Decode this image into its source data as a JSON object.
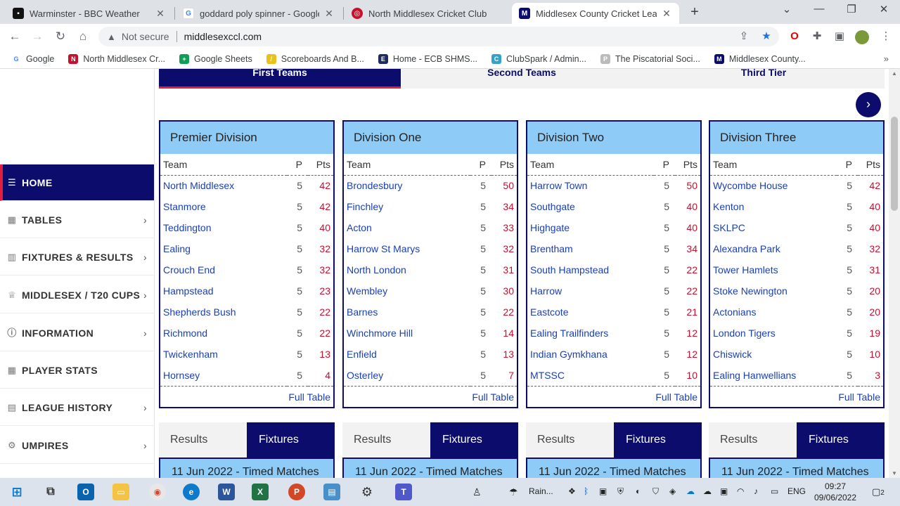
{
  "browser": {
    "tabs": [
      {
        "title": "Warminster - BBC Weather",
        "active": false
      },
      {
        "title": "goddard poly spinner - Google S",
        "active": false
      },
      {
        "title": "North Middlesex Cricket Club",
        "active": false
      },
      {
        "title": "Middlesex County Cricket League",
        "active": true
      }
    ],
    "new_tab": "+",
    "window": {
      "minimize": "—",
      "restore": "❐",
      "close": "✕",
      "tablist": "⌄"
    },
    "omnibox": {
      "security": "Not secure",
      "url": "middlesexccl.com"
    },
    "bookmarks": [
      {
        "label": "Google",
        "color": "#4285f4",
        "glyph": "G"
      },
      {
        "label": "North Middlesex Cr...",
        "color": "#c8102e",
        "glyph": "N"
      },
      {
        "label": "Google Sheets",
        "color": "#0f9d58",
        "glyph": "+"
      },
      {
        "label": "Scoreboards And B...",
        "color": "#e8c11a",
        "glyph": "/"
      },
      {
        "label": "Home - ECB SHMS...",
        "color": "#1f2b5c",
        "glyph": "E"
      },
      {
        "label": "ClubSpark / Admin...",
        "color": "#34a1c9",
        "glyph": "C"
      },
      {
        "label": "The Piscatorial Soci...",
        "color": "#bbbbbb",
        "glyph": "P"
      },
      {
        "label": "Middlesex County...",
        "color": "#0b0c6b",
        "glyph": "M"
      }
    ],
    "more": "»"
  },
  "sidebar": {
    "items": [
      {
        "label": "HOME",
        "icon": "☰",
        "active": true,
        "chevron": ""
      },
      {
        "label": "TABLES",
        "icon": "▦",
        "active": false,
        "chevron": "›"
      },
      {
        "label": "FIXTURES & RESULTS",
        "icon": "▥",
        "active": false,
        "chevron": "›"
      },
      {
        "label": "MIDDLESEX / T20 CUPS",
        "icon": "♕",
        "active": false,
        "chevron": "›"
      },
      {
        "label": "INFORMATION",
        "icon": "ⓘ",
        "active": false,
        "chevron": "›"
      },
      {
        "label": "PLAYER STATS",
        "icon": "▦",
        "active": false,
        "chevron": ""
      },
      {
        "label": "LEAGUE HISTORY",
        "icon": "▤",
        "active": false,
        "chevron": "›"
      },
      {
        "label": "UMPIRES",
        "icon": "⚙",
        "active": false,
        "chevron": "›"
      }
    ]
  },
  "top_tabs": [
    "First Teams",
    "Second Teams",
    "Third Tier"
  ],
  "next_arrow": "›",
  "columns": {
    "team": "Team",
    "p": "P",
    "pts": "Pts"
  },
  "full_table": "Full Table",
  "divisions": [
    {
      "name": "Premier Division",
      "rows": [
        {
          "team": "North Middlesex",
          "p": "5",
          "pts": "42"
        },
        {
          "team": "Stanmore",
          "p": "5",
          "pts": "42"
        },
        {
          "team": "Teddington",
          "p": "5",
          "pts": "40"
        },
        {
          "team": "Ealing",
          "p": "5",
          "pts": "32"
        },
        {
          "team": "Crouch End",
          "p": "5",
          "pts": "32"
        },
        {
          "team": "Hampstead",
          "p": "5",
          "pts": "23"
        },
        {
          "team": "Shepherds Bush",
          "p": "5",
          "pts": "22"
        },
        {
          "team": "Richmond",
          "p": "5",
          "pts": "22"
        },
        {
          "team": "Twickenham",
          "p": "5",
          "pts": "13"
        },
        {
          "team": "Hornsey",
          "p": "5",
          "pts": "4"
        }
      ]
    },
    {
      "name": "Division One",
      "rows": [
        {
          "team": "Brondesbury",
          "p": "5",
          "pts": "50"
        },
        {
          "team": "Finchley",
          "p": "5",
          "pts": "34"
        },
        {
          "team": "Acton",
          "p": "5",
          "pts": "33"
        },
        {
          "team": "Harrow St Marys",
          "p": "5",
          "pts": "32"
        },
        {
          "team": "North London",
          "p": "5",
          "pts": "31"
        },
        {
          "team": "Wembley",
          "p": "5",
          "pts": "30"
        },
        {
          "team": "Barnes",
          "p": "5",
          "pts": "22"
        },
        {
          "team": "Winchmore Hill",
          "p": "5",
          "pts": "14"
        },
        {
          "team": "Enfield",
          "p": "5",
          "pts": "13"
        },
        {
          "team": "Osterley",
          "p": "5",
          "pts": "7"
        }
      ]
    },
    {
      "name": "Division Two",
      "rows": [
        {
          "team": "Harrow Town",
          "p": "5",
          "pts": "50"
        },
        {
          "team": "Southgate",
          "p": "5",
          "pts": "40"
        },
        {
          "team": "Highgate",
          "p": "5",
          "pts": "40"
        },
        {
          "team": "Brentham",
          "p": "5",
          "pts": "34"
        },
        {
          "team": "South Hampstead",
          "p": "5",
          "pts": "22"
        },
        {
          "team": "Harrow",
          "p": "5",
          "pts": "22"
        },
        {
          "team": "Eastcote",
          "p": "5",
          "pts": "21"
        },
        {
          "team": "Ealing Trailfinders",
          "p": "5",
          "pts": "12"
        },
        {
          "team": "Indian Gymkhana",
          "p": "5",
          "pts": "12"
        },
        {
          "team": "MTSSC",
          "p": "5",
          "pts": "10"
        }
      ]
    },
    {
      "name": "Division Three",
      "rows": [
        {
          "team": "Wycombe House",
          "p": "5",
          "pts": "42"
        },
        {
          "team": "Kenton",
          "p": "5",
          "pts": "40"
        },
        {
          "team": "SKLPC",
          "p": "5",
          "pts": "40"
        },
        {
          "team": "Alexandra Park",
          "p": "5",
          "pts": "32"
        },
        {
          "team": "Tower Hamlets",
          "p": "5",
          "pts": "31"
        },
        {
          "team": "Stoke Newington",
          "p": "5",
          "pts": "20"
        },
        {
          "team": "Actonians",
          "p": "5",
          "pts": "20"
        },
        {
          "team": "London Tigers",
          "p": "5",
          "pts": "19"
        },
        {
          "team": "Chiswick",
          "p": "5",
          "pts": "10"
        },
        {
          "team": "Ealing Hanwellians",
          "p": "5",
          "pts": "3"
        }
      ]
    }
  ],
  "results_label": "Results",
  "fixtures_label": "Fixtures",
  "date_band": "11 Jun 2022 - Timed Matches",
  "taskbar": {
    "weather": "Rain...",
    "lang": "ENG",
    "time": "09:27",
    "date": "09/06/2022",
    "notifications": "2"
  },
  "colors": {
    "navy": "#0b0c6b",
    "light_blue": "#8ecbf7",
    "accent_red": "#c8102e",
    "link_blue": "#1a3fb5"
  }
}
